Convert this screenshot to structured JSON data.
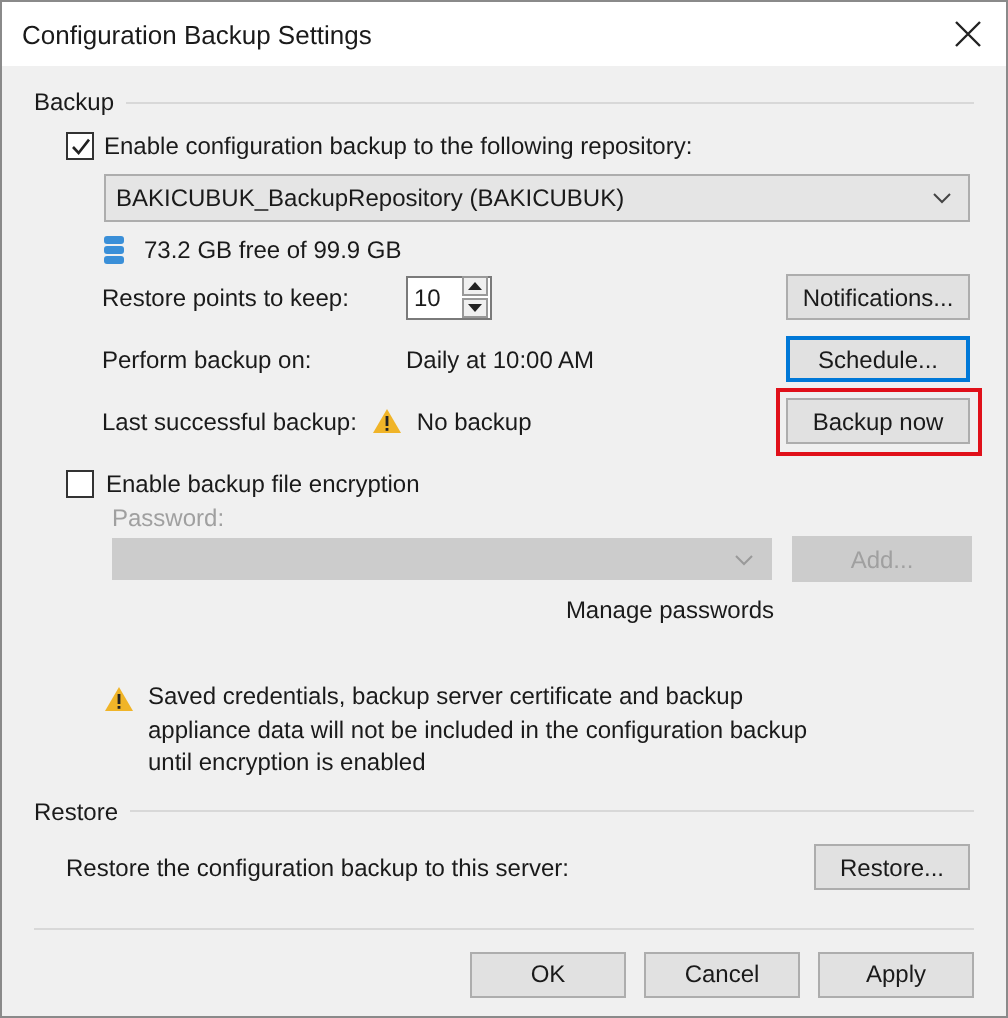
{
  "window": {
    "title": "Configuration Backup Settings"
  },
  "backup": {
    "heading": "Backup",
    "enable": {
      "label": "Enable configuration backup to the following repository:",
      "checked": true
    },
    "repository": {
      "value": "BAKICUBUK_BackupRepository (BAKICUBUK)"
    },
    "storage": "73.2 GB free of 99.9 GB",
    "restore_points": {
      "label": "Restore points to keep:",
      "value": "10"
    },
    "notifications_button": "Notifications...",
    "schedule": {
      "label": "Perform backup on:",
      "value": "Daily at 10:00 AM",
      "button": "Schedule...",
      "focused": true
    },
    "last_backup": {
      "label": "Last successful backup:",
      "value": "No backup",
      "warning": true
    },
    "backup_now": {
      "label": "Backup now",
      "highlighted": true
    },
    "encryption": {
      "label": "Enable backup file encryption",
      "checked": false
    },
    "password": {
      "label": "Password:",
      "disabled": true
    },
    "add_button": {
      "label": "Add...",
      "disabled": true
    },
    "manage_passwords": "Manage passwords",
    "notice": "Saved credentials, backup server certificate and backup appliance data will not be included in the configuration backup until encryption is enabled"
  },
  "restore": {
    "heading": "Restore",
    "label": "Restore the configuration backup to this server:",
    "button": "Restore..."
  },
  "buttons": [
    {
      "label": "OK"
    },
    {
      "label": "Cancel"
    },
    {
      "label": "Apply"
    }
  ]
}
